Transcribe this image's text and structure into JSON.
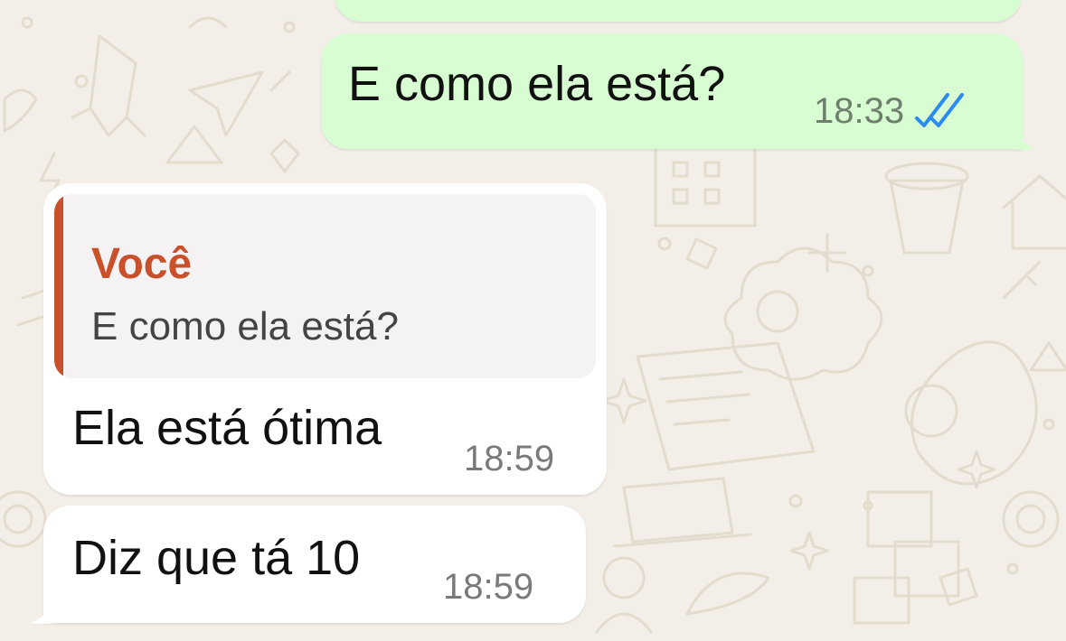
{
  "colors": {
    "wallpaper": "#f3efe8",
    "outgoing_bubble": "#d9fdd3",
    "incoming_bubble": "#ffffff",
    "quote_accent": "#c8502a",
    "read_ticks": "#2a8cf0"
  },
  "messages": [
    {
      "direction": "outgoing",
      "text": "E como ela está?",
      "time": "18:33",
      "status_icon": "double-check-read-icon"
    },
    {
      "direction": "incoming",
      "reply_to": {
        "author": "Você",
        "text": "E como ela está?"
      },
      "text": "Ela está ótima",
      "time": "18:59"
    },
    {
      "direction": "incoming",
      "text": "Diz que tá 10",
      "time": "18:59"
    }
  ]
}
